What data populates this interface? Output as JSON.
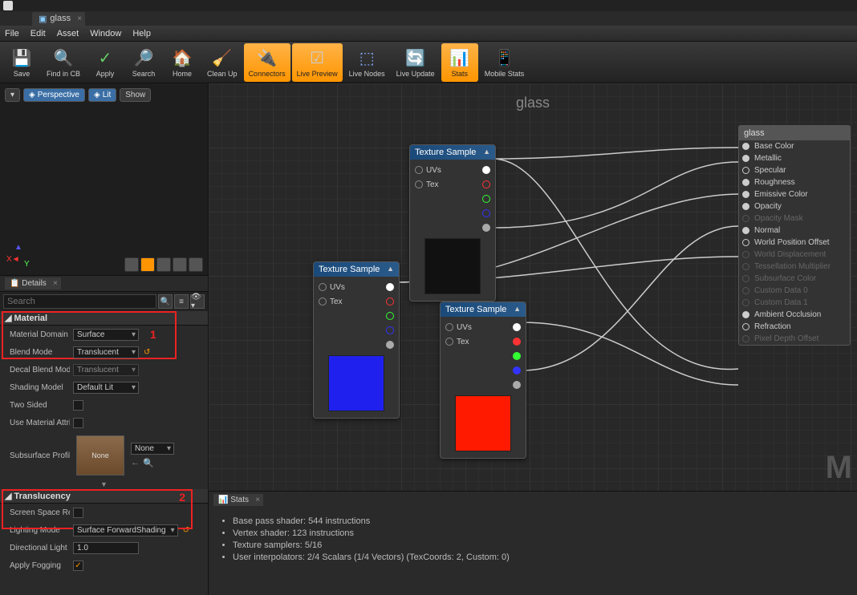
{
  "tab_title": "glass",
  "menu": {
    "file": "File",
    "edit": "Edit",
    "asset": "Asset",
    "window": "Window",
    "help": "Help"
  },
  "toolbar": {
    "save": "Save",
    "find": "Find in CB",
    "apply": "Apply",
    "search": "Search",
    "home": "Home",
    "cleanup": "Clean Up",
    "connectors": "Connectors",
    "livepreview": "Live Preview",
    "livenodes": "Live Nodes",
    "liveupdate": "Live Update",
    "stats": "Stats",
    "mobile": "Mobile Stats"
  },
  "viewport": {
    "perspective": "Perspective",
    "lit": "Lit",
    "show": "Show"
  },
  "details_tab": "Details",
  "search_placeholder": "Search",
  "material": {
    "header": "Material",
    "domain_label": "Material Domain",
    "domain_value": "Surface",
    "blend_label": "Blend Mode",
    "blend_value": "Translucent",
    "decal_label": "Decal Blend Mode",
    "decal_value": "Translucent",
    "shading_label": "Shading Model",
    "shading_value": "Default Lit",
    "twosided_label": "Two Sided",
    "usematattr_label": "Use Material Attributes",
    "subsurface_label": "Subsurface Profile",
    "subsurface_value": "None",
    "subsurface_sel": "None"
  },
  "translucency": {
    "header": "Translucency",
    "ssr_label": "Screen Space Reflections",
    "lighting_label": "Lighting Mode",
    "lighting_value": "Surface ForwardShading",
    "dirlight_label": "Directional Light",
    "dirlight_value": "1.0",
    "applyfog_label": "Apply Fogging"
  },
  "annotations": {
    "one": "1",
    "two": "2"
  },
  "graph_title": "glass",
  "nodes": {
    "texsample": "Texture Sample",
    "uvs": "UVs",
    "tex": "Tex"
  },
  "result": {
    "title": "glass",
    "pins": [
      "Base Color",
      "Metallic",
      "Specular",
      "Roughness",
      "Emissive Color",
      "Opacity",
      "Opacity Mask",
      "Normal",
      "World Position Offset",
      "World Displacement",
      "Tessellation Multiplier",
      "Subsurface Color",
      "Custom Data 0",
      "Custom Data 1",
      "Ambient Occlusion",
      "Refraction",
      "Pixel Depth Offset"
    ],
    "disabled": [
      6,
      9,
      10,
      11,
      12,
      13,
      16
    ]
  },
  "stats": {
    "tab": "Stats",
    "lines": [
      "Base pass shader: 544 instructions",
      "Vertex shader: 123 instructions",
      "Texture samplers: 5/16",
      "User interpolators: 2/4 Scalars (1/4 Vectors) (TexCoords: 2, Custom: 0)"
    ]
  }
}
